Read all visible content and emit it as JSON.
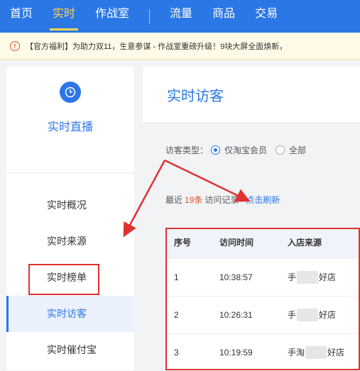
{
  "topnav": {
    "items": [
      {
        "label": "首页",
        "active": false
      },
      {
        "label": "实时",
        "active": true
      },
      {
        "label": "作战室",
        "active": false
      },
      {
        "label": "流量",
        "active": false
      },
      {
        "label": "商品",
        "active": false
      },
      {
        "label": "交易",
        "active": false
      }
    ]
  },
  "notice": {
    "text": "【官方福利】为助力双11，生意参谋 - 作战室重磅升级！9块大屏全面焕新，"
  },
  "sidebar": {
    "title": "实时直播",
    "items": [
      {
        "label": "实时概况",
        "active": false
      },
      {
        "label": "实时来源",
        "active": false
      },
      {
        "label": "实时榜单",
        "active": false
      },
      {
        "label": "实时访客",
        "active": true
      },
      {
        "label": "实时催付宝",
        "active": false
      }
    ]
  },
  "main": {
    "title": "实时访客",
    "filter": {
      "label": "访客类型：",
      "options": [
        {
          "label": "仅淘宝会员",
          "checked": true
        },
        {
          "label": "全部",
          "checked": false
        }
      ]
    },
    "records": {
      "prefix": "最近",
      "count": "19条",
      "suffix": "访问记录",
      "refresh": "点击刷新"
    },
    "table": {
      "headers": [
        "序号",
        "访问时间",
        "入店来源"
      ],
      "rows": [
        {
          "index": "1",
          "time": "10:38:57",
          "source_start": "手",
          "source_end": "好店"
        },
        {
          "index": "2",
          "time": "10:26:31",
          "source_start": "手",
          "source_end": "好店"
        },
        {
          "index": "3",
          "time": "10:19:59",
          "source_start": "手淘",
          "source_end": "好店"
        }
      ]
    }
  },
  "colors": {
    "brand": "#2b77e6",
    "nav_active": "#ffd34d",
    "annotation_red": "#e03131",
    "count": "#e8512e"
  }
}
